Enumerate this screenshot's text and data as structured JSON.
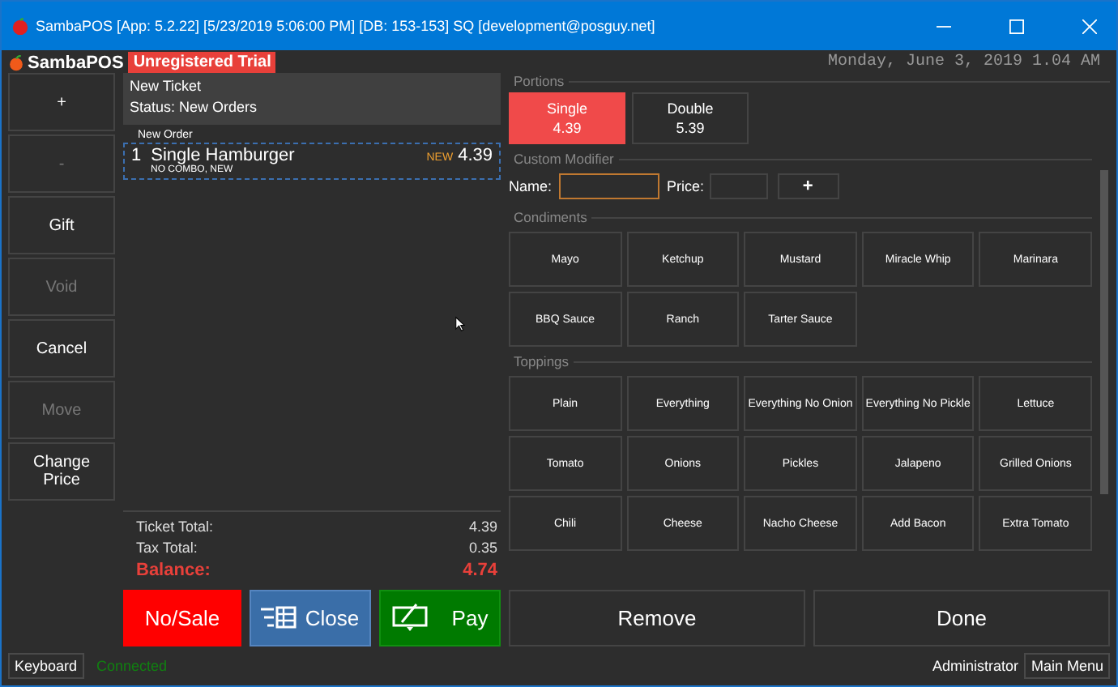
{
  "window": {
    "title": "SambaPOS [App: 5.2.22] [5/23/2019 5:06:00 PM] [DB: 153-153] SQ [development@posguy.net]"
  },
  "header": {
    "logo_text": "SambaPOS",
    "trial_badge": "Unregistered Trial",
    "datetime": "Monday, June 3, 2019 1.04 AM"
  },
  "left_buttons": [
    {
      "label": "+",
      "disabled": false
    },
    {
      "label": "-",
      "disabled": true
    },
    {
      "label": "Gift",
      "disabled": false
    },
    {
      "label": "Void",
      "disabled": true
    },
    {
      "label": "Cancel",
      "disabled": false
    },
    {
      "label": "Move",
      "disabled": true
    },
    {
      "label": "Change Price",
      "disabled": false
    }
  ],
  "ticket": {
    "title": "New Ticket",
    "status": "Status: New Orders",
    "group_label": "New Order",
    "orders": [
      {
        "quantity": "1",
        "name": "Single Hamburger",
        "tag": "NEW",
        "price": "4.39",
        "note": "NO COMBO, NEW",
        "selected": true
      }
    ],
    "totals": [
      {
        "label": "Ticket Total:",
        "value": "4.39",
        "kind": "normal"
      },
      {
        "label": "Tax Total:",
        "value": "0.35",
        "kind": "normal"
      },
      {
        "label": "Balance:",
        "value": "4.74",
        "kind": "balance"
      }
    ]
  },
  "portions": {
    "label": "Portions",
    "items": [
      {
        "name": "Single",
        "price": "4.39",
        "selected": true
      },
      {
        "name": "Double",
        "price": "5.39",
        "selected": false
      }
    ]
  },
  "custom_modifier": {
    "label": "Custom Modifier",
    "name_label": "Name:",
    "price_label": "Price:",
    "add_button": "+"
  },
  "modifier_groups": [
    {
      "label": "Condiments",
      "items": [
        "Mayo",
        "Ketchup",
        "Mustard",
        "Miracle Whip",
        "Marinara",
        "BBQ Sauce",
        "Ranch",
        "Tarter Sauce"
      ]
    },
    {
      "label": "Toppings",
      "items": [
        "Plain",
        "Everything",
        "Everything No Onion",
        "Everything No Pickle",
        "Lettuce",
        "Tomato",
        "Onions",
        "Pickles",
        "Jalapeno",
        "Grilled Onions",
        "Chili",
        "Cheese",
        "Nacho Cheese",
        "Add Bacon",
        "Extra Tomato"
      ]
    }
  ],
  "action_buttons": [
    {
      "label": "No/Sale",
      "kind": "nosale"
    },
    {
      "label": "Close",
      "kind": "close"
    },
    {
      "label": "Pay",
      "kind": "pay"
    }
  ],
  "modifier_actions": [
    "Remove",
    "Done"
  ],
  "status_bar": {
    "keyboard": "Keyboard",
    "connection": "Connected",
    "user": "Administrator",
    "main_menu": "Main Menu"
  }
}
